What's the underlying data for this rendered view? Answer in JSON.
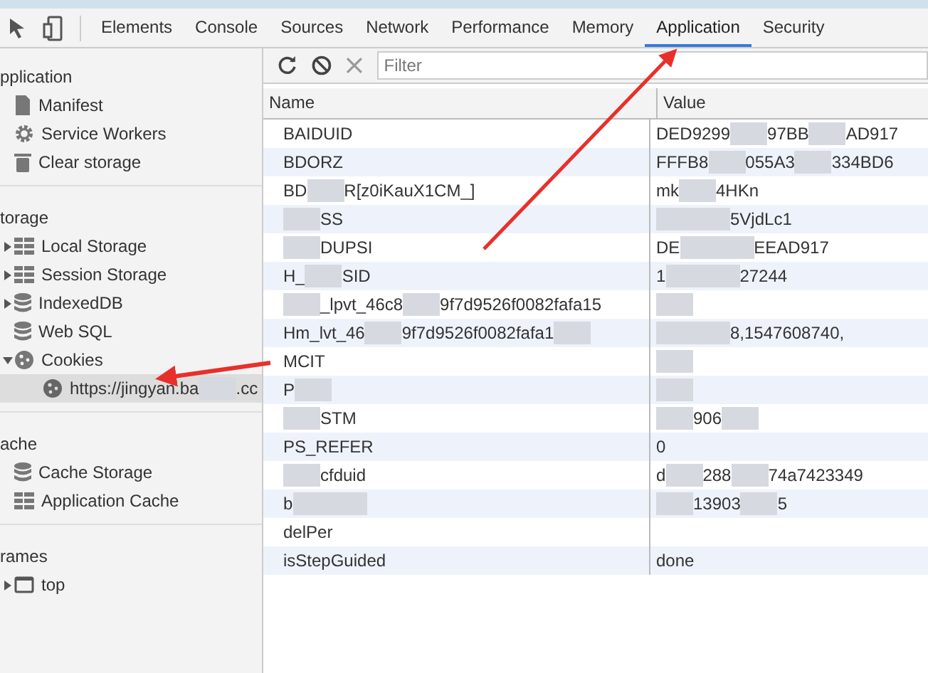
{
  "tabs": [
    {
      "label": "Elements",
      "selected": false
    },
    {
      "label": "Console",
      "selected": false
    },
    {
      "label": "Sources",
      "selected": false
    },
    {
      "label": "Network",
      "selected": false
    },
    {
      "label": "Performance",
      "selected": false
    },
    {
      "label": "Memory",
      "selected": false
    },
    {
      "label": "Application",
      "selected": true
    },
    {
      "label": "Security",
      "selected": false
    }
  ],
  "sidebar": {
    "sections": [
      {
        "title": "pplication",
        "items": [
          {
            "kind": "file",
            "label": [
              {
                "kind": "text",
                "text": "Manifest"
              }
            ],
            "selected": false
          },
          {
            "kind": "gear",
            "label": [
              {
                "kind": "text",
                "text": "Service Workers"
              }
            ],
            "selected": false
          },
          {
            "kind": "trash",
            "label": [
              {
                "kind": "text",
                "text": "Clear storage"
              }
            ],
            "selected": false
          }
        ]
      },
      {
        "title": "torage",
        "items": [
          {
            "kind": "grid",
            "label": [
              {
                "kind": "text",
                "text": "Local Storage"
              }
            ],
            "expanded": false,
            "selected": false
          },
          {
            "kind": "grid",
            "label": [
              {
                "kind": "text",
                "text": "Session Storage"
              }
            ],
            "expanded": false,
            "selected": false
          },
          {
            "kind": "database",
            "label": [
              {
                "kind": "text",
                "text": "IndexedDB"
              }
            ],
            "expanded": false,
            "selected": false
          },
          {
            "kind": "database",
            "label": [
              {
                "kind": "text",
                "text": "Web SQL"
              }
            ],
            "selected": false
          },
          {
            "kind": "cookie",
            "label": [
              {
                "kind": "text",
                "text": "Cookies"
              }
            ],
            "expanded": true,
            "selected": false,
            "children": [
              {
                "kind": "cookie",
                "label": [
                  {
                    "kind": "text",
                    "text": "https://jingyan.ba"
                  },
                  {
                    "kind": "mask"
                  },
                  {
                    "kind": "text",
                    "text": ".cc"
                  }
                ],
                "selected": true
              }
            ]
          }
        ]
      },
      {
        "title": "ache",
        "items": [
          {
            "kind": "database",
            "label": [
              {
                "kind": "text",
                "text": "Cache Storage"
              }
            ],
            "selected": false
          },
          {
            "kind": "grid",
            "label": [
              {
                "kind": "text",
                "text": "Application Cache"
              }
            ],
            "selected": false
          }
        ]
      },
      {
        "title": "rames",
        "items": [
          {
            "kind": "window",
            "label": [
              {
                "kind": "text",
                "text": "top"
              }
            ],
            "expanded": false,
            "selected": false
          }
        ]
      }
    ]
  },
  "toolbar": {
    "filter": {
      "placeholder": "Filter"
    }
  },
  "table": {
    "columns": [
      "Name",
      "Value"
    ],
    "rows": [
      {
        "name": [
          {
            "kind": "text",
            "text": "BAIDUID"
          }
        ],
        "value": [
          {
            "kind": "text",
            "text": "DED9299"
          },
          {
            "kind": "mask"
          },
          {
            "kind": "text",
            "text": "97BB"
          },
          {
            "kind": "mask"
          },
          {
            "kind": "text",
            "text": "AD917"
          }
        ]
      },
      {
        "name": [
          {
            "kind": "text",
            "text": "BDORZ"
          }
        ],
        "value": [
          {
            "kind": "text",
            "text": "FFFB8"
          },
          {
            "kind": "mask"
          },
          {
            "kind": "text",
            "text": "055A3"
          },
          {
            "kind": "mask"
          },
          {
            "kind": "text",
            "text": "334BD6"
          }
        ]
      },
      {
        "name": [
          {
            "kind": "text",
            "text": "BD"
          },
          {
            "kind": "mask"
          },
          {
            "kind": "text",
            "text": "R[z0iKauX1CM_]"
          }
        ],
        "value": [
          {
            "kind": "text",
            "text": "mk"
          },
          {
            "kind": "mask"
          },
          {
            "kind": "text",
            "text": "4HKn"
          }
        ]
      },
      {
        "name": [
          {
            "kind": "mask"
          },
          {
            "kind": "text",
            "text": "SS"
          }
        ],
        "value": [
          {
            "kind": "mask"
          },
          {
            "kind": "mask"
          },
          {
            "kind": "text",
            "text": "5VjdLc1"
          }
        ]
      },
      {
        "name": [
          {
            "kind": "mask"
          },
          {
            "kind": "text",
            "text": "DUPSI"
          }
        ],
        "value": [
          {
            "kind": "text",
            "text": "DE"
          },
          {
            "kind": "mask"
          },
          {
            "kind": "mask"
          },
          {
            "kind": "text",
            "text": "EEAD917"
          }
        ]
      },
      {
        "name": [
          {
            "kind": "text",
            "text": "H_"
          },
          {
            "kind": "mask"
          },
          {
            "kind": "text",
            "text": "SID"
          }
        ],
        "value": [
          {
            "kind": "text",
            "text": "1"
          },
          {
            "kind": "mask"
          },
          {
            "kind": "mask"
          },
          {
            "kind": "text",
            "text": "27244"
          }
        ]
      },
      {
        "name": [
          {
            "kind": "mask"
          },
          {
            "kind": "text",
            "text": "_lpvt_46c8"
          },
          {
            "kind": "mask"
          },
          {
            "kind": "text",
            "text": "9f7d9526f0082fafa15"
          }
        ],
        "value": [
          {
            "kind": "mask"
          }
        ]
      },
      {
        "name": [
          {
            "kind": "text",
            "text": "Hm_lvt_46"
          },
          {
            "kind": "mask"
          },
          {
            "kind": "text",
            "text": "9f7d9526f0082fafa1"
          },
          {
            "kind": "mask"
          }
        ],
        "value": [
          {
            "kind": "mask"
          },
          {
            "kind": "mask"
          },
          {
            "kind": "text",
            "text": "8,1547608740,"
          }
        ]
      },
      {
        "name": [
          {
            "kind": "text",
            "text": "MCIT"
          }
        ],
        "value": [
          {
            "kind": "mask"
          }
        ]
      },
      {
        "name": [
          {
            "kind": "text",
            "text": "P"
          },
          {
            "kind": "mask"
          }
        ],
        "value": [
          {
            "kind": "mask"
          }
        ]
      },
      {
        "name": [
          {
            "kind": "mask"
          },
          {
            "kind": "text",
            "text": "STM"
          }
        ],
        "value": [
          {
            "kind": "mask"
          },
          {
            "kind": "text",
            "text": "906"
          },
          {
            "kind": "mask"
          }
        ]
      },
      {
        "name": [
          {
            "kind": "text",
            "text": "PS_REFER"
          }
        ],
        "value": [
          {
            "kind": "text",
            "text": "0"
          }
        ]
      },
      {
        "name": [
          {
            "kind": "mask"
          },
          {
            "kind": "text",
            "text": "cfduid"
          }
        ],
        "value": [
          {
            "kind": "text",
            "text": "d"
          },
          {
            "kind": "mask"
          },
          {
            "kind": "text",
            "text": "288"
          },
          {
            "kind": "mask"
          },
          {
            "kind": "text",
            "text": "74a7423349"
          }
        ]
      },
      {
        "name": [
          {
            "kind": "text",
            "text": "b"
          },
          {
            "kind": "mask"
          },
          {
            "kind": "mask"
          }
        ],
        "value": [
          {
            "kind": "mask"
          },
          {
            "kind": "text",
            "text": "13903"
          },
          {
            "kind": "mask"
          },
          {
            "kind": "text",
            "text": "5"
          }
        ]
      },
      {
        "name": [
          {
            "kind": "text",
            "text": "delPer"
          }
        ],
        "value": []
      },
      {
        "name": [
          {
            "kind": "text",
            "text": "isStepGuided"
          }
        ],
        "value": [
          {
            "kind": "text",
            "text": "done"
          }
        ]
      }
    ]
  }
}
